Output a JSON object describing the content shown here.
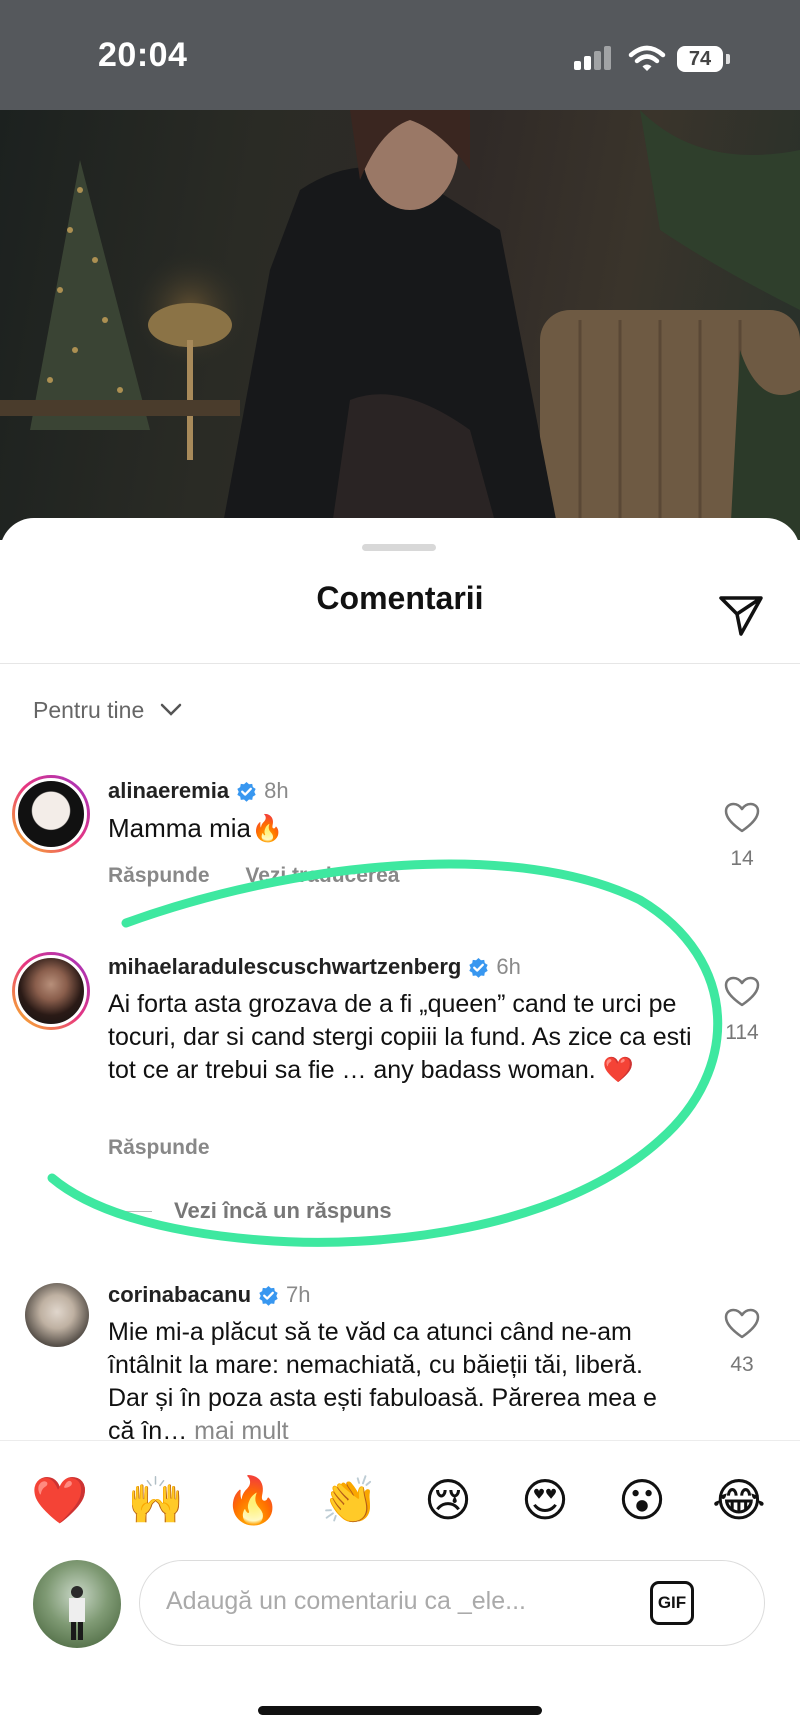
{
  "status_bar": {
    "time": "20:04",
    "battery": "74"
  },
  "sheet": {
    "title": "Comentarii",
    "sort_label": "Pentru tine"
  },
  "comments": [
    {
      "user": "alinaeremia",
      "time": "8h",
      "text": "Mamma mia🔥",
      "actions": [
        "Răspunde",
        "Vezi traducerea"
      ],
      "likes": "14"
    },
    {
      "user": "mihaelaradulescuschwartzenberg",
      "time": "6h",
      "text": "Ai forta asta grozava de a fi „queen” cand te urci pe tocuri, dar si cand stergi copiii la fund. As zice ca esti tot ce ar trebui sa fie … any badass woman. ❤️",
      "actions": [
        "Răspunde"
      ],
      "likes": "114",
      "more_replies": "Vezi încă un răspuns"
    },
    {
      "user": "corinabacanu",
      "time": "7h",
      "text": "Mie mi-a plăcut să te văd ca atunci când ne-am întâlnit la mare: nemachiată, cu băieții tăi, liberă. Dar și în poza asta ești fabuloasă. Părerea mea e că în…",
      "more": "mai mult",
      "likes": "43"
    }
  ],
  "reactions": [
    "❤️",
    "🙌",
    "🔥",
    "👏",
    "😢",
    "😍",
    "😮",
    "😂"
  ],
  "input": {
    "placeholder": "Adaugă un comentariu ca _ele...",
    "gif_label": "GIF"
  },
  "colors": {
    "annotation_green": "#3ee8a0",
    "verified_blue": "#3897f0"
  }
}
